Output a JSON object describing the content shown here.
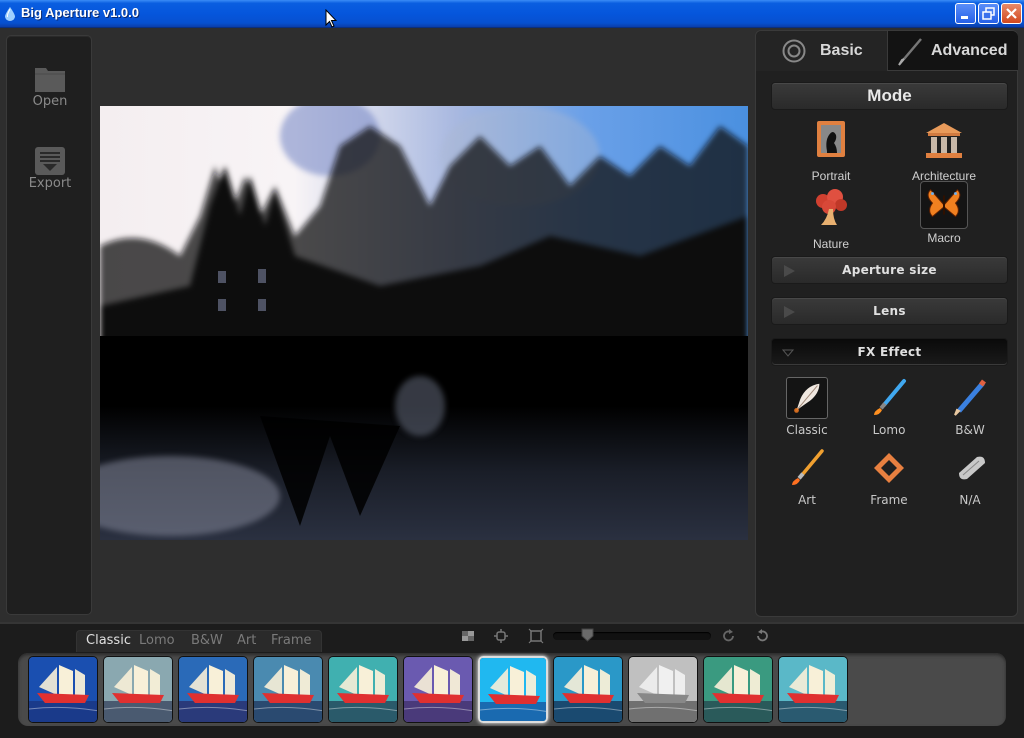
{
  "window": {
    "title": "Big Aperture v1.0.0",
    "controls": [
      "minimize",
      "restore",
      "close"
    ]
  },
  "sidebar": {
    "items": [
      {
        "label": "Open",
        "icon": "folder-icon"
      },
      {
        "label": "Export",
        "icon": "export-icon"
      }
    ]
  },
  "preview": {
    "description": "Dusk lake scene with silhouetted castle and bare trees, reflected in water"
  },
  "panel": {
    "tabs": [
      {
        "label": "Basic",
        "icon": "aperture-icon",
        "active": true
      },
      {
        "label": "Advanced",
        "icon": "brush-icon",
        "active": false
      }
    ],
    "mode": {
      "title": "Mode",
      "items": [
        {
          "label": "Portrait",
          "icon": "portrait-icon",
          "selected": false
        },
        {
          "label": "Architecture",
          "icon": "architecture-icon",
          "selected": false
        },
        {
          "label": "Nature",
          "icon": "tree-icon",
          "selected": false
        },
        {
          "label": "Macro",
          "icon": "butterfly-icon",
          "selected": true
        }
      ]
    },
    "sections": [
      {
        "label": "Aperture size",
        "expanded": false
      },
      {
        "label": "Lens",
        "expanded": false
      },
      {
        "label": "FX Effect",
        "expanded": true
      }
    ],
    "fx": {
      "items": [
        {
          "label": "Classic",
          "icon": "feather-icon",
          "selected": true
        },
        {
          "label": "Lomo",
          "icon": "paintbrush-icon",
          "selected": false
        },
        {
          "label": "B&W",
          "icon": "pencil-icon",
          "selected": false
        },
        {
          "label": "Art",
          "icon": "art-brush-icon",
          "selected": false
        },
        {
          "label": "Frame",
          "icon": "frame-icon",
          "selected": false
        },
        {
          "label": "N/A",
          "icon": "eraser-icon",
          "selected": false
        }
      ]
    }
  },
  "filmstrip": {
    "tabs": [
      {
        "label": "Classic",
        "active": true
      },
      {
        "label": "Lomo",
        "active": false
      },
      {
        "label": "B&W",
        "active": false
      },
      {
        "label": "Art",
        "active": false
      },
      {
        "label": "Frame",
        "active": false
      }
    ],
    "tools": [
      "compare-icon",
      "fit-icon",
      "crop-icon",
      "rotate-right-icon",
      "rotate-left-icon"
    ],
    "zoom_slider_fraction": 0.18,
    "thumbnails": [
      {
        "tint": "#1a4fb0",
        "sea": "#1a3a8a",
        "selected": false
      },
      {
        "tint": "#8aa8b0",
        "sea": "#4a5a70",
        "selected": false
      },
      {
        "tint": "#2a6ab8",
        "sea": "#2a3a7a",
        "selected": false
      },
      {
        "tint": "#4a8ab0",
        "sea": "#2a4a70",
        "selected": false
      },
      {
        "tint": "#40b0b0",
        "sea": "#2a5a6a",
        "selected": false
      },
      {
        "tint": "#6a5ab0",
        "sea": "#4a3a7a",
        "selected": false
      },
      {
        "tint": "#20b8f0",
        "sea": "#1a6ab0",
        "selected": true
      },
      {
        "tint": "#2a98c8",
        "sea": "#1a4a70",
        "selected": false
      },
      {
        "tint": "#c0c0c0",
        "sea": "#707070",
        "selected": false
      },
      {
        "tint": "#3a9a80",
        "sea": "#2a5a5a",
        "selected": false
      },
      {
        "tint": "#5ab8c8",
        "sea": "#2a5a70",
        "selected": false
      }
    ]
  }
}
